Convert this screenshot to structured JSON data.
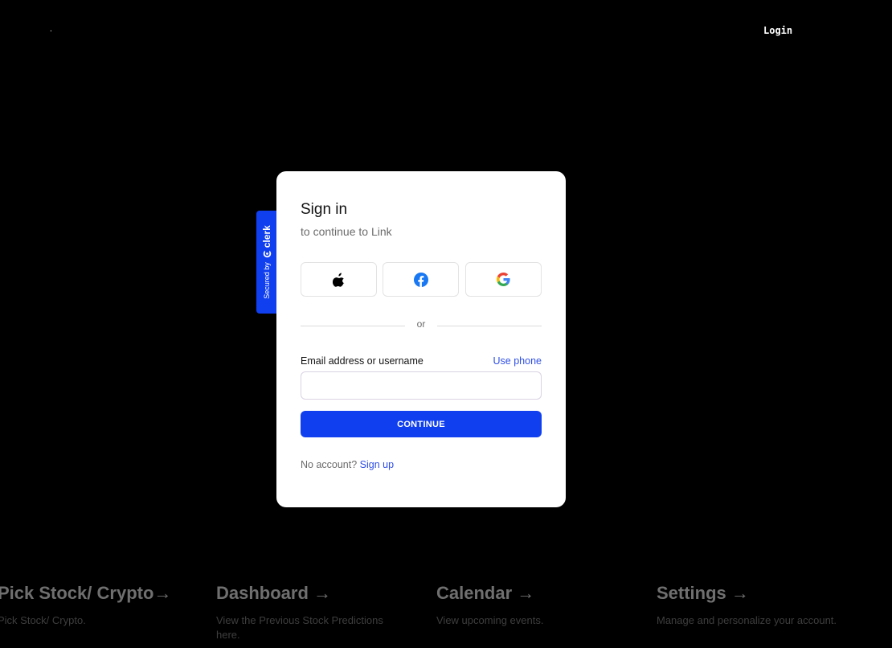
{
  "nav": {
    "logo_dot": ".",
    "login_label": "Login"
  },
  "badge": {
    "secured_by": "Secured by",
    "brand": "clerk",
    "color": "#103fef"
  },
  "signin": {
    "title": "Sign in",
    "subtitle": "to continue to Link",
    "social": [
      {
        "provider": "apple",
        "icon": "apple-icon"
      },
      {
        "provider": "facebook",
        "icon": "facebook-icon"
      },
      {
        "provider": "google",
        "icon": "google-icon"
      }
    ],
    "divider_text": "or",
    "email_label": "Email address or username",
    "use_phone_label": "Use phone",
    "email_value": "",
    "continue_label": "CONTINUE",
    "no_account_text": "No account?",
    "signup_label": "Sign up",
    "accent_color": "#103fef"
  },
  "features": [
    {
      "title": "Pick Stock/ Crypto→",
      "description": "Pick Stock/ Crypto."
    },
    {
      "title": "Dashboard →",
      "description": "View the Previous Stock Predictions here."
    },
    {
      "title": "Calendar →",
      "description": "View upcoming events."
    },
    {
      "title": "Settings →",
      "description": "Manage and personalize your account."
    }
  ]
}
